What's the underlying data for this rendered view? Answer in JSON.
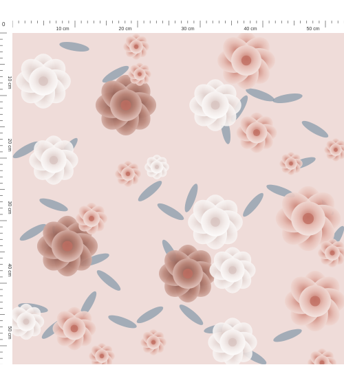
{
  "ruler": {
    "corner_label": "0",
    "unit": "cm",
    "top_labels": [
      "10 cm",
      "20 cm",
      "30 cm",
      "40 cm",
      "50 cm"
    ],
    "left_labels": [
      "10 cm",
      "20 cm",
      "30 cm",
      "40 cm",
      "50 cm"
    ]
  },
  "fabric": {
    "background_color": "#efdcd9",
    "leaf_color": "#8a9cab",
    "flower_palette": [
      "#f3e6e3",
      "#e5bab1",
      "#c98b7f",
      "#b07b6f",
      "#ffffff"
    ]
  }
}
